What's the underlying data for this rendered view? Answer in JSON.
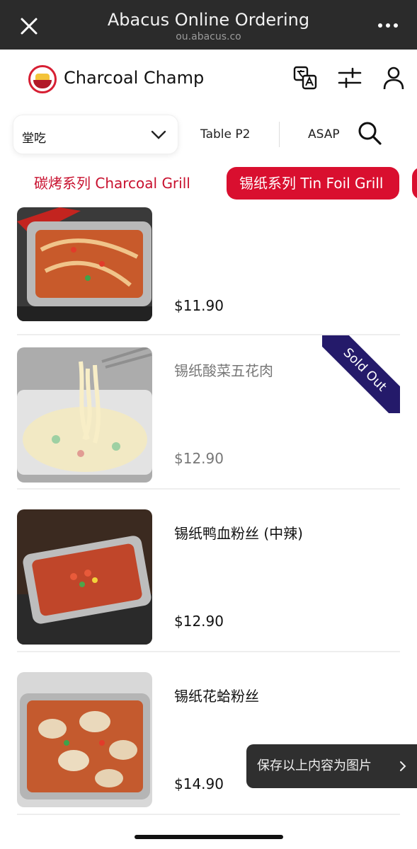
{
  "browser": {
    "title": "Abacus Online Ordering",
    "url": "ou.abacus.co",
    "close_icon": "close-icon",
    "more_icon": "more-icon"
  },
  "header": {
    "brand": "Charcoal Champ",
    "icons": [
      "translate-icon",
      "filter-icon",
      "account-icon"
    ]
  },
  "controls": {
    "dining_option": "堂吃",
    "table": "Table P2",
    "time": "ASAP"
  },
  "tabs": [
    {
      "label": "碳烤系列 Charcoal Grill",
      "active": false
    },
    {
      "label": "锡纸系列 Tin Foil Grill",
      "active": true
    }
  ],
  "items": [
    {
      "name": "",
      "price": "$11.90",
      "sold_out": false
    },
    {
      "name": "锡纸酸菜五花肉",
      "price": "$12.90",
      "sold_out": true,
      "badge": "Sold Out"
    },
    {
      "name": "锡纸鸭血粉丝 (中辣)",
      "price": "$12.90",
      "sold_out": false
    },
    {
      "name": "锡纸花蛤粉丝",
      "price": "$14.90",
      "sold_out": false
    }
  ],
  "toast": {
    "label": "保存以上内容为图片"
  },
  "colors": {
    "brand_red": "#d90f2f",
    "sold_out_ribbon": "#241a6a"
  }
}
